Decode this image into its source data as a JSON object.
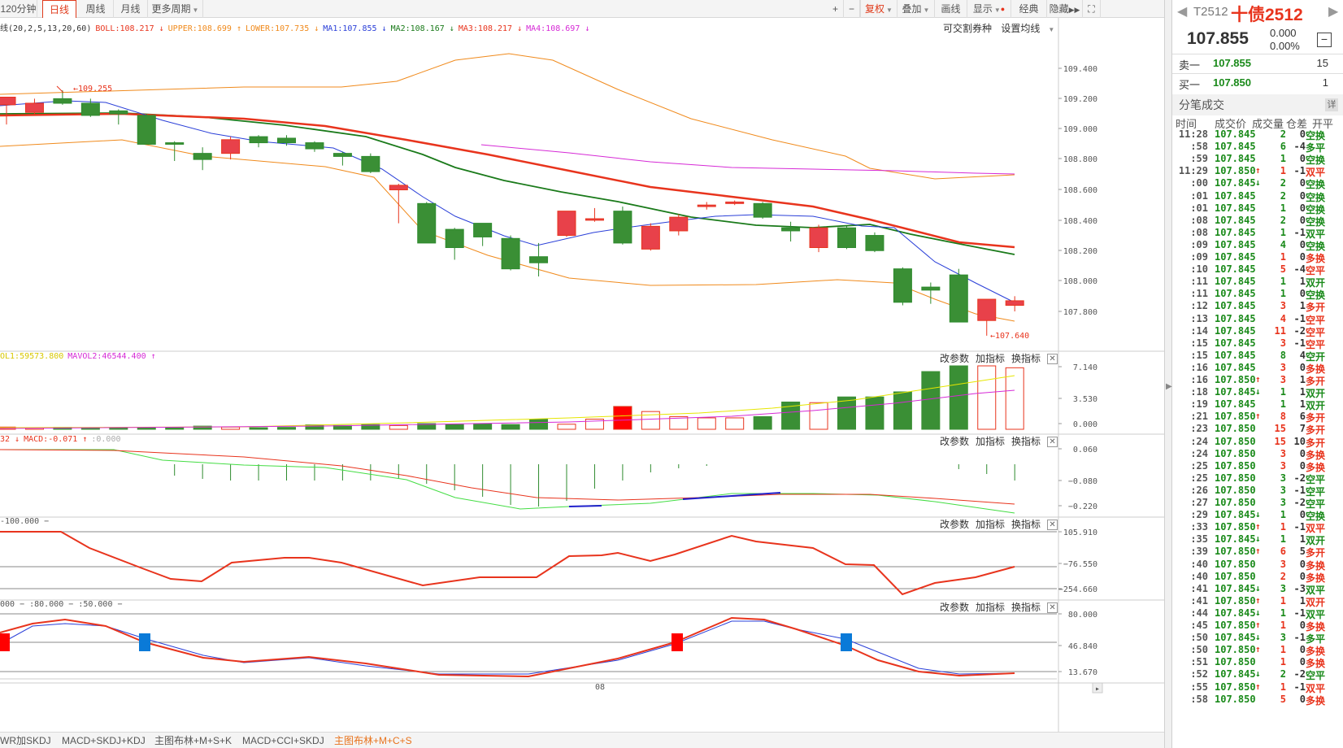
{
  "toolbar": {
    "periods": [
      "120分钟",
      "日线",
      "周线",
      "月线",
      "更多周期"
    ],
    "active_period": "日线",
    "right_buttons": [
      "+",
      "−",
      "复权",
      "叠加",
      "画线",
      "显示",
      "经典",
      "隐藏",
      "⛶"
    ]
  },
  "main_legend": {
    "name": "线(20,2,5,13,20,60)",
    "items": [
      {
        "text": "BOLL:108.217",
        "arrow": "↓",
        "color": "#e8341d"
      },
      {
        "text": "UPPER:108.699",
        "arrow": "↑",
        "color": "#f08a1c"
      },
      {
        "text": "LOWER:107.735",
        "arrow": "↓",
        "color": "#f08a1c"
      },
      {
        "text": "MA1:107.855",
        "arrow": "↓",
        "color": "#2a3fd8"
      },
      {
        "text": "MA2:108.167",
        "arrow": "↓",
        "color": "#1a7a1a"
      },
      {
        "text": "MA3:108.217",
        "arrow": "↓",
        "color": "#e8341d"
      },
      {
        "text": "MA4:108.697",
        "arrow": "↓",
        "color": "#d62ad6"
      }
    ],
    "tools": [
      "可交割券种",
      "设置均线"
    ]
  },
  "vol_legend": {
    "items": [
      {
        "text": "OL1:59573.800",
        "color": "#d8c800"
      },
      {
        "text": "MAVOL2:46544.400",
        "arrow": "↑",
        "color": "#d62ad6"
      }
    ]
  },
  "macd_legend": {
    "items": [
      {
        "text": "32",
        "arrow": "↓",
        "color": "#e8341d"
      },
      {
        "text": "MACD:-0.071",
        "arrow": "↑",
        "color": "#e8341d"
      },
      {
        "text": ":0.000",
        "color": "#aaaaaa"
      }
    ]
  },
  "cci_legend": {
    "items": [
      {
        "text": "-100.000 −",
        "color": "#555555"
      }
    ]
  },
  "kdj_legend": {
    "items": [
      {
        "text": "000 − :80.000 − :50.000 −",
        "color": "#555555"
      }
    ]
  },
  "panel_tools": [
    "改参数",
    "加指标",
    "换指标"
  ],
  "axes": {
    "main": [
      "109.400",
      "109.200",
      "109.000",
      "108.800",
      "108.600",
      "108.400",
      "108.200",
      "108.000",
      "107.800"
    ],
    "vol": [
      "7.140",
      "3.530",
      "0.000"
    ],
    "macd": [
      "0.060",
      "−0.080",
      "−0.220"
    ],
    "cci": [
      "105.910",
      "−76.550",
      "−254.660"
    ],
    "kdj": [
      "80.000",
      "46.840",
      "13.670"
    ],
    "x_label": "08",
    "high_label": "109.255",
    "low_label": "107.640"
  },
  "chart_data": {
    "type": "candlestick",
    "ylim": [
      107.63,
      109.5
    ],
    "candles": [
      {
        "o": 109.16,
        "h": 109.2,
        "l": 109.03,
        "c": 109.21
      },
      {
        "o": 109.11,
        "h": 109.2,
        "l": 109.09,
        "c": 109.17
      },
      {
        "o": 109.2,
        "h": 109.255,
        "l": 109.16,
        "c": 109.17
      },
      {
        "o": 109.17,
        "h": 109.2,
        "l": 109.08,
        "c": 109.09
      },
      {
        "o": 109.12,
        "h": 109.13,
        "l": 109.03,
        "c": 109.1
      },
      {
        "o": 109.09,
        "h": 109.1,
        "l": 108.9,
        "c": 108.9
      },
      {
        "o": 108.91,
        "h": 108.92,
        "l": 108.79,
        "c": 108.9
      },
      {
        "o": 108.84,
        "h": 108.88,
        "l": 108.73,
        "c": 108.8
      },
      {
        "o": 108.84,
        "h": 108.95,
        "l": 108.8,
        "c": 108.93
      },
      {
        "o": 108.95,
        "h": 108.96,
        "l": 108.88,
        "c": 108.91
      },
      {
        "o": 108.94,
        "h": 108.96,
        "l": 108.89,
        "c": 108.91
      },
      {
        "o": 108.91,
        "h": 108.92,
        "l": 108.85,
        "c": 108.87
      },
      {
        "o": 108.84,
        "h": 108.85,
        "l": 108.76,
        "c": 108.82
      },
      {
        "o": 108.82,
        "h": 108.84,
        "l": 108.71,
        "c": 108.72
      },
      {
        "o": 108.6,
        "h": 108.64,
        "l": 108.38,
        "c": 108.63
      },
      {
        "o": 108.51,
        "h": 108.52,
        "l": 108.25,
        "c": 108.25
      },
      {
        "o": 108.34,
        "h": 108.35,
        "l": 108.14,
        "c": 108.22
      },
      {
        "o": 108.38,
        "h": 108.38,
        "l": 108.23,
        "c": 108.29
      },
      {
        "o": 108.28,
        "h": 108.3,
        "l": 108.07,
        "c": 108.08
      },
      {
        "o": 108.16,
        "h": 108.25,
        "l": 108.03,
        "c": 108.12
      },
      {
        "o": 108.3,
        "h": 108.46,
        "l": 108.29,
        "c": 108.46
      },
      {
        "o": 108.4,
        "h": 108.48,
        "l": 108.39,
        "c": 108.41
      },
      {
        "o": 108.46,
        "h": 108.49,
        "l": 108.24,
        "c": 108.25
      },
      {
        "o": 108.21,
        "h": 108.38,
        "l": 108.2,
        "c": 108.36
      },
      {
        "o": 108.33,
        "h": 108.44,
        "l": 108.3,
        "c": 108.42
      },
      {
        "o": 108.49,
        "h": 108.52,
        "l": 108.47,
        "c": 108.5
      },
      {
        "o": 108.51,
        "h": 108.53,
        "l": 108.5,
        "c": 108.52
      },
      {
        "o": 108.51,
        "h": 108.52,
        "l": 108.41,
        "c": 108.42
      },
      {
        "o": 108.35,
        "h": 108.39,
        "l": 108.26,
        "c": 108.33
      },
      {
        "o": 108.22,
        "h": 108.37,
        "l": 108.19,
        "c": 108.35
      },
      {
        "o": 108.35,
        "h": 108.36,
        "l": 108.21,
        "c": 108.22
      },
      {
        "o": 108.3,
        "h": 108.32,
        "l": 108.19,
        "c": 108.2
      },
      {
        "o": 108.08,
        "h": 108.09,
        "l": 107.84,
        "c": 107.86
      },
      {
        "o": 107.96,
        "h": 107.99,
        "l": 107.85,
        "c": 107.94
      },
      {
        "o": 108.04,
        "h": 108.08,
        "l": 107.73,
        "c": 107.73
      },
      {
        "o": 107.74,
        "h": 107.86,
        "l": 107.64,
        "c": 107.88
      },
      {
        "o": 107.84,
        "h": 107.9,
        "l": 107.8,
        "c": 107.87
      }
    ]
  },
  "right_panel": {
    "code": "T2512",
    "name": "十债2512",
    "price": "107.855",
    "change": "0.000",
    "change_pct": "0.00%",
    "ask": {
      "label": "卖一",
      "price": "107.855",
      "vol": "15"
    },
    "bid": {
      "label": "买一",
      "price": "107.850",
      "vol": "1"
    },
    "trades_title": "分笔成交",
    "detail_label": "详",
    "columns": [
      "时间",
      "成交价",
      "成交量",
      "仓差",
      "开平"
    ],
    "trades": [
      {
        "t": "11:28",
        "p": "107.845",
        "a": "",
        "v": "2",
        "pos": "0",
        "k": "空换",
        "c": "g"
      },
      {
        "t": ":58",
        "p": "107.845",
        "a": "",
        "v": "6",
        "pos": "-4",
        "k": "多平",
        "c": "g"
      },
      {
        "t": ":59",
        "p": "107.845",
        "a": "",
        "v": "1",
        "pos": "0",
        "k": "空换",
        "c": "g"
      },
      {
        "t": "11:29",
        "p": "107.850",
        "a": "↑",
        "v": "1",
        "pos": "-1",
        "k": "双平",
        "c": "r"
      },
      {
        "t": ":00",
        "p": "107.845",
        "a": "↓",
        "v": "2",
        "pos": "0",
        "k": "空换",
        "c": "g"
      },
      {
        "t": ":01",
        "p": "107.845",
        "a": "",
        "v": "2",
        "pos": "0",
        "k": "空换",
        "c": "g"
      },
      {
        "t": ":01",
        "p": "107.845",
        "a": "",
        "v": "1",
        "pos": "0",
        "k": "空换",
        "c": "g"
      },
      {
        "t": ":08",
        "p": "107.845",
        "a": "",
        "v": "2",
        "pos": "0",
        "k": "空换",
        "c": "g"
      },
      {
        "t": ":08",
        "p": "107.845",
        "a": "",
        "v": "1",
        "pos": "-1",
        "k": "双平",
        "c": "g"
      },
      {
        "t": ":09",
        "p": "107.845",
        "a": "",
        "v": "4",
        "pos": "0",
        "k": "空换",
        "c": "g"
      },
      {
        "t": ":09",
        "p": "107.845",
        "a": "",
        "v": "1",
        "pos": "0",
        "k": "多换",
        "c": "r"
      },
      {
        "t": ":10",
        "p": "107.845",
        "a": "",
        "v": "5",
        "pos": "-4",
        "k": "空平",
        "c": "r"
      },
      {
        "t": ":11",
        "p": "107.845",
        "a": "",
        "v": "1",
        "pos": "1",
        "k": "双开",
        "c": "g"
      },
      {
        "t": ":11",
        "p": "107.845",
        "a": "",
        "v": "1",
        "pos": "0",
        "k": "空换",
        "c": "g"
      },
      {
        "t": ":12",
        "p": "107.845",
        "a": "",
        "v": "3",
        "pos": "1",
        "k": "多开",
        "c": "r"
      },
      {
        "t": ":13",
        "p": "107.845",
        "a": "",
        "v": "4",
        "pos": "-1",
        "k": "空平",
        "c": "r"
      },
      {
        "t": ":14",
        "p": "107.845",
        "a": "",
        "v": "11",
        "pos": "-2",
        "k": "空平",
        "c": "r"
      },
      {
        "t": ":15",
        "p": "107.845",
        "a": "",
        "v": "3",
        "pos": "-1",
        "k": "空平",
        "c": "r"
      },
      {
        "t": ":15",
        "p": "107.845",
        "a": "",
        "v": "8",
        "pos": "4",
        "k": "空开",
        "c": "g"
      },
      {
        "t": ":16",
        "p": "107.845",
        "a": "",
        "v": "3",
        "pos": "0",
        "k": "多换",
        "c": "r"
      },
      {
        "t": ":16",
        "p": "107.850",
        "a": "↑",
        "v": "3",
        "pos": "1",
        "k": "多开",
        "c": "r"
      },
      {
        "t": ":18",
        "p": "107.845",
        "a": "↓",
        "v": "1",
        "pos": "1",
        "k": "双开",
        "c": "g"
      },
      {
        "t": ":19",
        "p": "107.845",
        "a": "",
        "v": "1",
        "pos": "1",
        "k": "双开",
        "c": "g"
      },
      {
        "t": ":21",
        "p": "107.850",
        "a": "↑",
        "v": "8",
        "pos": "6",
        "k": "多开",
        "c": "r"
      },
      {
        "t": ":23",
        "p": "107.850",
        "a": "",
        "v": "15",
        "pos": "7",
        "k": "多开",
        "c": "r"
      },
      {
        "t": ":24",
        "p": "107.850",
        "a": "",
        "v": "15",
        "pos": "10",
        "k": "多开",
        "c": "r"
      },
      {
        "t": ":24",
        "p": "107.850",
        "a": "",
        "v": "3",
        "pos": "0",
        "k": "多换",
        "c": "r"
      },
      {
        "t": ":25",
        "p": "107.850",
        "a": "",
        "v": "3",
        "pos": "0",
        "k": "多换",
        "c": "r"
      },
      {
        "t": ":25",
        "p": "107.850",
        "a": "",
        "v": "3",
        "pos": "-2",
        "k": "空平",
        "c": "g"
      },
      {
        "t": ":26",
        "p": "107.850",
        "a": "",
        "v": "3",
        "pos": "-1",
        "k": "空平",
        "c": "g"
      },
      {
        "t": ":27",
        "p": "107.850",
        "a": "",
        "v": "3",
        "pos": "-2",
        "k": "空平",
        "c": "g"
      },
      {
        "t": ":29",
        "p": "107.845",
        "a": "↓",
        "v": "1",
        "pos": "0",
        "k": "空换",
        "c": "g"
      },
      {
        "t": ":33",
        "p": "107.850",
        "a": "↑",
        "v": "1",
        "pos": "-1",
        "k": "双平",
        "c": "r"
      },
      {
        "t": ":35",
        "p": "107.845",
        "a": "↓",
        "v": "1",
        "pos": "1",
        "k": "双开",
        "c": "g"
      },
      {
        "t": ":39",
        "p": "107.850",
        "a": "↑",
        "v": "6",
        "pos": "5",
        "k": "多开",
        "c": "r"
      },
      {
        "t": ":40",
        "p": "107.850",
        "a": "",
        "v": "3",
        "pos": "0",
        "k": "多换",
        "c": "r"
      },
      {
        "t": ":40",
        "p": "107.850",
        "a": "",
        "v": "2",
        "pos": "0",
        "k": "多换",
        "c": "r"
      },
      {
        "t": ":41",
        "p": "107.845",
        "a": "↓",
        "v": "3",
        "pos": "-3",
        "k": "双平",
        "c": "g"
      },
      {
        "t": ":41",
        "p": "107.850",
        "a": "↑",
        "v": "1",
        "pos": "1",
        "k": "双开",
        "c": "r"
      },
      {
        "t": ":44",
        "p": "107.845",
        "a": "↓",
        "v": "1",
        "pos": "-1",
        "k": "双平",
        "c": "g"
      },
      {
        "t": ":45",
        "p": "107.850",
        "a": "↑",
        "v": "1",
        "pos": "0",
        "k": "多换",
        "c": "r"
      },
      {
        "t": ":50",
        "p": "107.845",
        "a": "↓",
        "v": "3",
        "pos": "-1",
        "k": "多平",
        "c": "g"
      },
      {
        "t": ":50",
        "p": "107.850",
        "a": "↑",
        "v": "1",
        "pos": "0",
        "k": "多换",
        "c": "r"
      },
      {
        "t": ":51",
        "p": "107.850",
        "a": "",
        "v": "1",
        "pos": "0",
        "k": "多换",
        "c": "r"
      },
      {
        "t": ":52",
        "p": "107.845",
        "a": "↓",
        "v": "2",
        "pos": "-2",
        "k": "空平",
        "c": "g"
      },
      {
        "t": ":55",
        "p": "107.850",
        "a": "↑",
        "v": "1",
        "pos": "-1",
        "k": "双平",
        "c": "r"
      },
      {
        "t": ":58",
        "p": "107.850",
        "a": "",
        "v": "5",
        "pos": "0",
        "k": "多换",
        "c": "r"
      }
    ]
  },
  "bottom_tabs": [
    "WR加SKDJ",
    "MACD+SKDJ+KDJ",
    "主图布林+M+S+K",
    "MACD+CCI+SKDJ",
    "主图布林+M+C+S"
  ],
  "active_bottom_tab": "主图布林+M+C+S"
}
